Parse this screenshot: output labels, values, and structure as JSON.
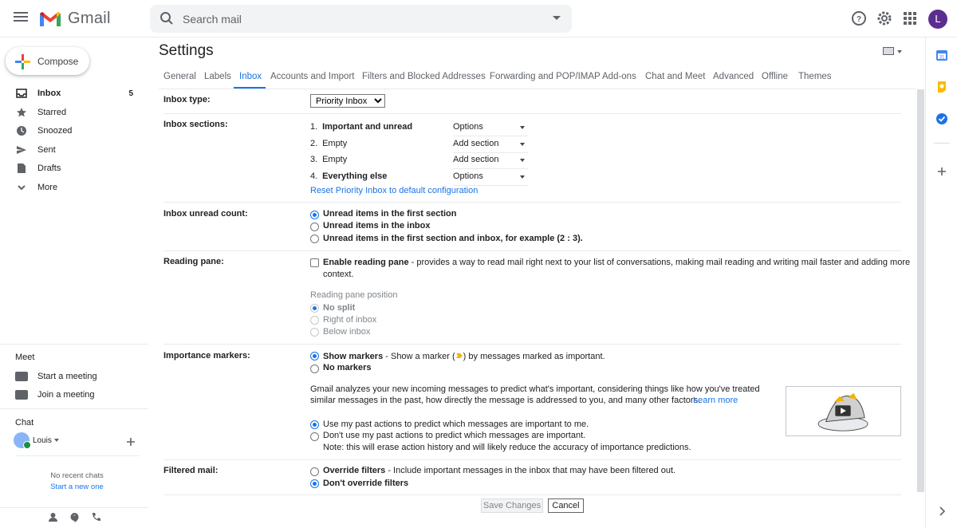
{
  "header": {
    "app_name": "Gmail",
    "search_placeholder": "Search mail",
    "avatar_letter": "L"
  },
  "nav": {
    "compose_label": "Compose",
    "items": [
      {
        "label": "Inbox",
        "count": "5"
      },
      {
        "label": "Starred"
      },
      {
        "label": "Snoozed"
      },
      {
        "label": "Sent"
      },
      {
        "label": "Drafts"
      },
      {
        "label": "More"
      }
    ]
  },
  "meet": {
    "title": "Meet",
    "start": "Start a meeting",
    "join": "Join a meeting"
  },
  "chat": {
    "title": "Chat",
    "user": "Louis",
    "empty_text": "No recent chats",
    "new_link": "Start a new one"
  },
  "settings": {
    "title": "Settings",
    "tabs": [
      "General",
      "Labels",
      "Inbox",
      "Accounts and Import",
      "Filters and Blocked Addresses",
      "Forwarding and POP/IMAP",
      "Add-ons",
      "Chat and Meet",
      "Advanced",
      "Offline",
      "Themes"
    ],
    "active_tab": "Inbox",
    "inbox_type": {
      "label": "Inbox type:",
      "value": "Priority Inbox"
    },
    "inbox_sections": {
      "label": "Inbox sections:",
      "sections": [
        {
          "num": "1.",
          "name": "Important and unread",
          "action": "Options"
        },
        {
          "num": "2.",
          "name": "Empty",
          "action": "Add section"
        },
        {
          "num": "3.",
          "name": "Empty",
          "action": "Add section"
        },
        {
          "num": "4.",
          "name": "Everything else",
          "action": "Options"
        }
      ],
      "reset_link": "Reset Priority Inbox to default configuration"
    },
    "unread_count": {
      "label": "Inbox unread count:",
      "options": [
        "Unread items in the first section",
        "Unread items in the inbox",
        "Unread items in the first section and inbox, for example (2 : 3)."
      ]
    },
    "reading_pane": {
      "label": "Reading pane:",
      "enable_bold": "Enable reading pane",
      "enable_rest": " - provides a way to read mail right next to your list of conversations, making mail reading and writing mail faster and adding more",
      "enable_rest2": "context.",
      "position_title": "Reading pane position",
      "positions": [
        "No split",
        "Right of inbox",
        "Below inbox"
      ]
    },
    "importance": {
      "label": "Importance markers:",
      "show_bold": "Show markers",
      "show_rest_a": " - Show a marker (",
      "show_rest_b": ") by messages marked as important.",
      "no_markers": "No markers",
      "desc_line1": "Gmail analyzes your new incoming messages to predict what's important, considering things like how you've treated",
      "desc_line2": "similar messages in the past, how directly the message is addressed to you, and many other factors.",
      "learn_more": "Learn more",
      "use_past": "Use my past actions to predict which messages are important to me.",
      "dont_use_1": "Don't use my past actions to predict which messages are important.",
      "dont_use_2": "Note: this will erase action history and will likely reduce the accuracy of importance predictions."
    },
    "filtered": {
      "label": "Filtered mail:",
      "override_bold": "Override filters",
      "override_rest": " - Include important messages in the inbox that may have been filtered out.",
      "dont_override": "Don't override filters"
    },
    "buttons": {
      "save": "Save Changes",
      "cancel": "Cancel"
    }
  },
  "colors": {
    "accent": "#1a73e8",
    "gmail_red": "#ea4335",
    "marker_yellow": "#f4b400"
  }
}
